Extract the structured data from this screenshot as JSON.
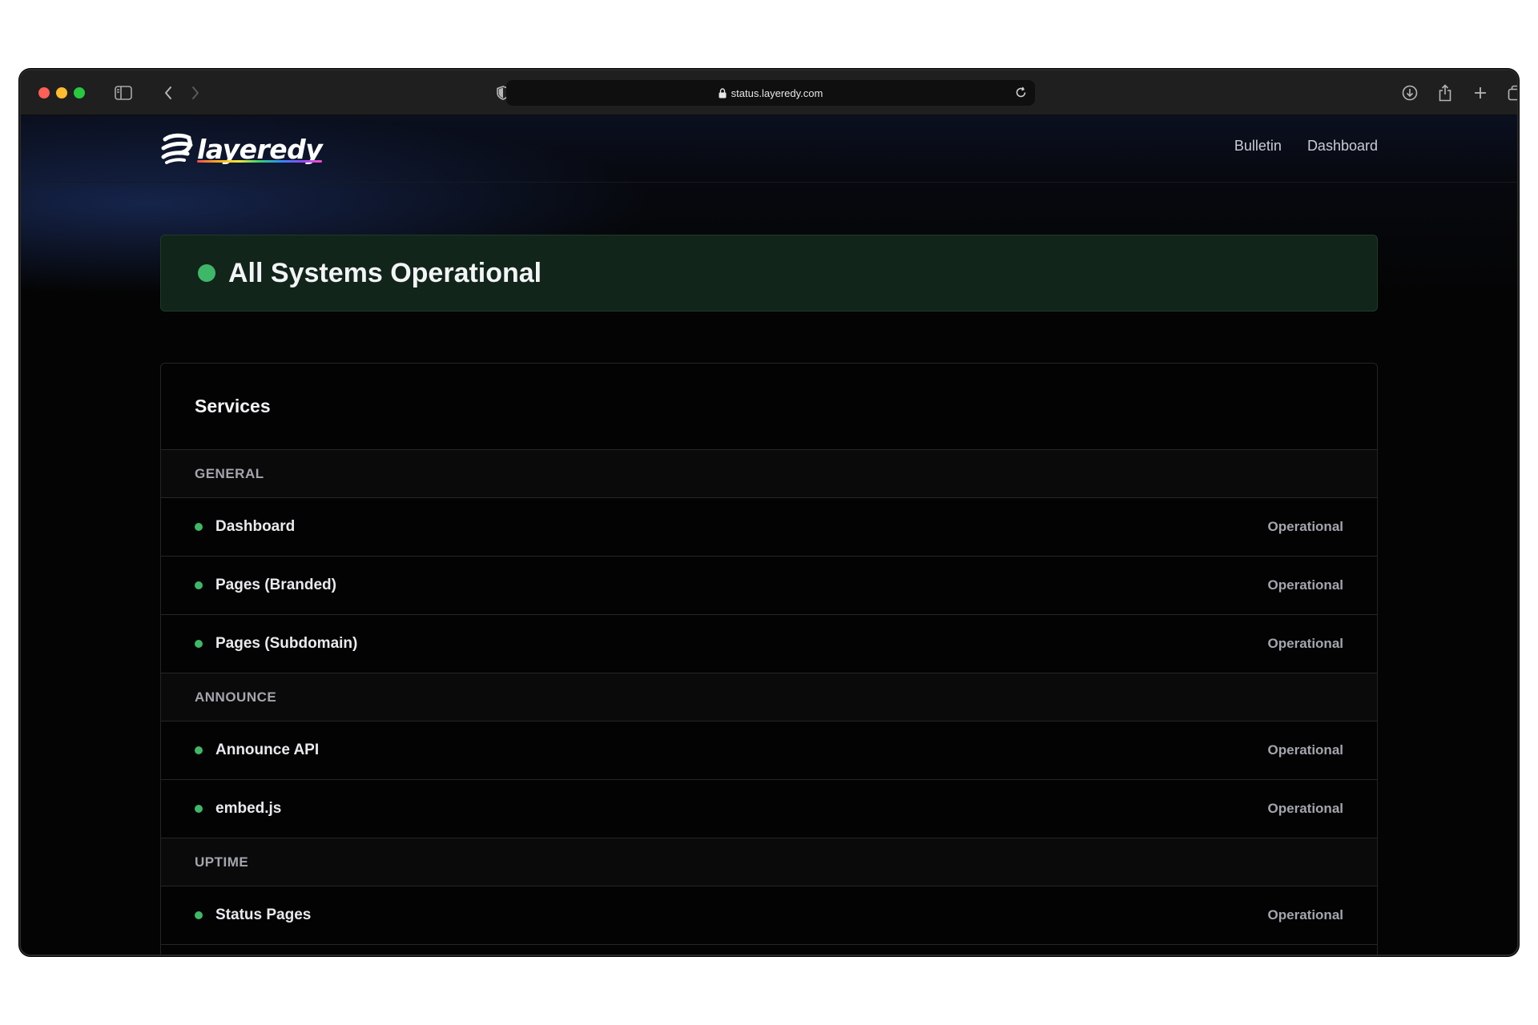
{
  "browser": {
    "url": "status.layeredy.com"
  },
  "site": {
    "logo_text": "layeredy",
    "nav": [
      {
        "label": "Bulletin"
      },
      {
        "label": "Dashboard"
      }
    ]
  },
  "banner": {
    "title": "All Systems Operational",
    "color": "#3fb768"
  },
  "services": {
    "title": "Services",
    "groups": [
      {
        "label": "GENERAL",
        "items": [
          {
            "name": "Dashboard",
            "status": "Operational"
          },
          {
            "name": "Pages (Branded)",
            "status": "Operational"
          },
          {
            "name": "Pages (Subdomain)",
            "status": "Operational"
          }
        ]
      },
      {
        "label": "ANNOUNCE",
        "items": [
          {
            "name": "Announce API",
            "status": "Operational"
          },
          {
            "name": "embed.js",
            "status": "Operational"
          }
        ]
      },
      {
        "label": "UPTIME",
        "items": [
          {
            "name": "Status Pages",
            "status": "Operational"
          }
        ]
      }
    ]
  }
}
